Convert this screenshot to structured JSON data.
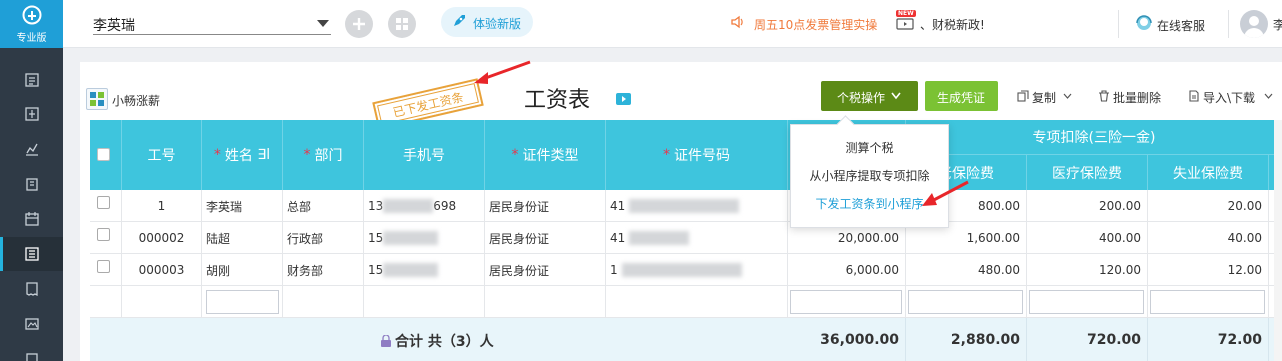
{
  "brand": {
    "edition": "专业版"
  },
  "topbar": {
    "company": "李英瑞",
    "try_new": "体验新版",
    "notice": "周五10点发票管理实操",
    "news_badge": "NEW",
    "news": "、财税新政!",
    "service": "在线客服",
    "user_name": "李"
  },
  "toolbar": {
    "xc_label": "小畅涨薪",
    "stamp": "已下发工资条",
    "title": "工资表",
    "tax_btn": "个税操作",
    "voucher_btn": "生成凭证",
    "copy": "复制",
    "batch_delete": "批量删除",
    "import_export": "导入\\下载"
  },
  "table": {
    "headers": {
      "id": "工号",
      "name": "姓名",
      "name_suffix": "∃l",
      "dept": "部门",
      "phone": "手机号",
      "id_type": "证件类型",
      "id_no": "证件号码",
      "group": "专项扣除(三险一金)",
      "pension": "老保险费",
      "medical": "医疗保险费",
      "unemp": "失业保险费"
    },
    "rows": [
      {
        "id": "1",
        "name": "李英瑞",
        "dept": "总部",
        "phone_pre": "13",
        "phone_suf": "698",
        "id_type": "居民身份证",
        "id_pre": "41",
        "salary": "",
        "pension": "800.00",
        "medical": "200.00",
        "unemp": "20.00"
      },
      {
        "id": "000002",
        "name": "陆超",
        "dept": "行政部",
        "phone_pre": "15",
        "phone_suf": "",
        "id_type": "居民身份证",
        "id_pre": "41",
        "salary": "20,000.00",
        "pension": "1,600.00",
        "medical": "400.00",
        "unemp": "40.00"
      },
      {
        "id": "000003",
        "name": "胡刚",
        "dept": "财务部",
        "phone_pre": "15",
        "phone_suf": "",
        "id_type": "居民身份证",
        "id_pre": "1",
        "salary": "6,000.00",
        "pension": "480.00",
        "medical": "120.00",
        "unemp": "12.00"
      }
    ],
    "total_label": "合计 共（3）人",
    "totals": {
      "salary": "36,000.00",
      "pension": "2,880.00",
      "medical": "720.00",
      "unemp": "72.00"
    }
  },
  "menu": {
    "items": [
      "测算个税",
      "从小程序提取专项扣除",
      "下发工资条到小程序"
    ]
  },
  "colors": {
    "accent": "#3ec5dd",
    "tax_btn": "#5c8a16",
    "voucher_btn": "#7bc234",
    "stamp": "#e8a23a",
    "arrow": "#e8262a"
  }
}
